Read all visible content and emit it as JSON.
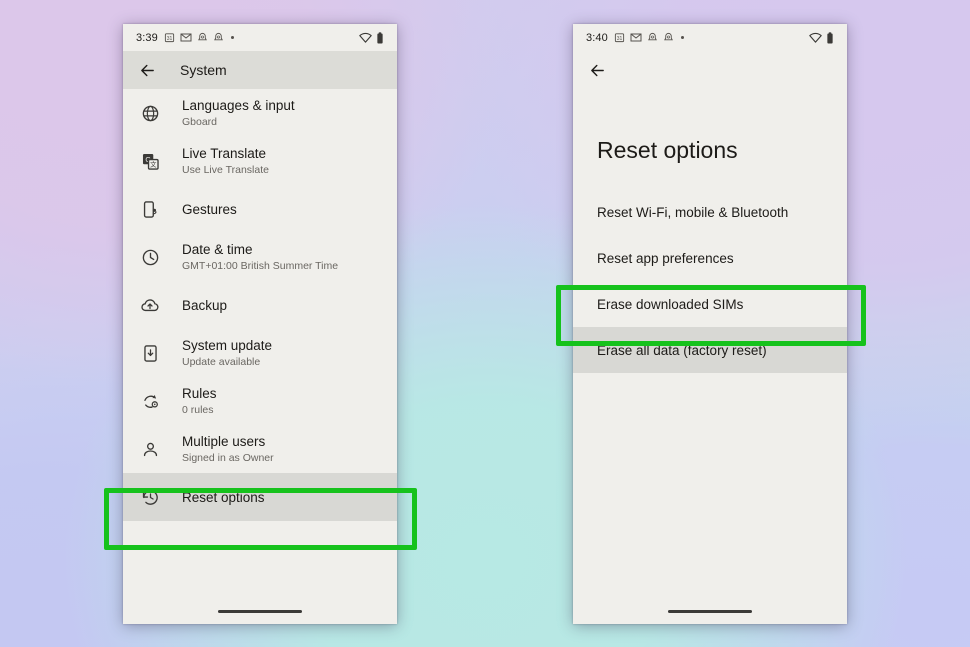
{
  "background": {
    "accent_green": "#16c21c",
    "phone_surface": "#f0efeb",
    "appbar_surface": "#dcdcd7",
    "row_highlight": "#d8d8d4"
  },
  "left_phone": {
    "status_bar": {
      "time": "3:39",
      "icons": [
        "calendar-icon",
        "gmail-icon",
        "notification-icon",
        "notification-icon",
        "more-dot-icon"
      ],
      "right_icons": [
        "wifi-icon",
        "battery-icon"
      ]
    },
    "app_bar": {
      "back_label": "back-arrow-icon",
      "title": "System"
    },
    "items": [
      {
        "icon": "globe-icon",
        "title": "Languages & input",
        "subtitle": "Gboard"
      },
      {
        "icon": "translate-icon",
        "title": "Live Translate",
        "subtitle": "Use Live Translate"
      },
      {
        "icon": "gestures-icon",
        "title": "Gestures",
        "subtitle": ""
      },
      {
        "icon": "clock-icon",
        "title": "Date & time",
        "subtitle": "GMT+01:00 British Summer Time"
      },
      {
        "icon": "cloud-upload-icon",
        "title": "Backup",
        "subtitle": ""
      },
      {
        "icon": "system-update-icon",
        "title": "System update",
        "subtitle": "Update available"
      },
      {
        "icon": "rules-icon",
        "title": "Rules",
        "subtitle": "0 rules"
      },
      {
        "icon": "person-icon",
        "title": "Multiple users",
        "subtitle": "Signed in as Owner"
      },
      {
        "icon": "history-icon",
        "title": "Reset options",
        "subtitle": "",
        "highlighted": true
      }
    ]
  },
  "right_phone": {
    "status_bar": {
      "time": "3:40",
      "icons": [
        "calendar-icon",
        "gmail-icon",
        "notification-icon",
        "notification-icon",
        "more-dot-icon"
      ],
      "right_icons": [
        "wifi-icon",
        "battery-icon"
      ]
    },
    "app_bar": {
      "back_label": "back-arrow-icon",
      "title": ""
    },
    "page_title": "Reset options",
    "options": [
      {
        "label": "Reset Wi-Fi, mobile & Bluetooth"
      },
      {
        "label": "Reset app preferences"
      },
      {
        "label": "Erase downloaded SIMs"
      },
      {
        "label": "Erase all data (factory reset)",
        "highlighted": true
      }
    ]
  }
}
